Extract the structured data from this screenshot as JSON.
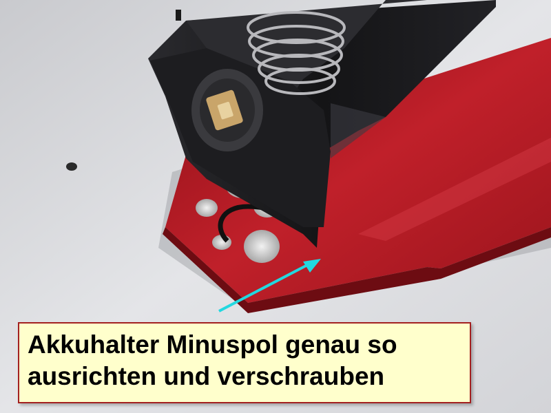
{
  "caption": {
    "line1": "Akkuhalter Minuspol genau so",
    "line2": "ausrichten und verschrauben"
  },
  "colors": {
    "background": "#d9dade",
    "pcb_red": "#b51820",
    "holder_black": "#1a1a1c",
    "arrow_cyan": "#22d8e0",
    "caption_fill": "#ffffcc",
    "caption_border": "#a32020"
  }
}
